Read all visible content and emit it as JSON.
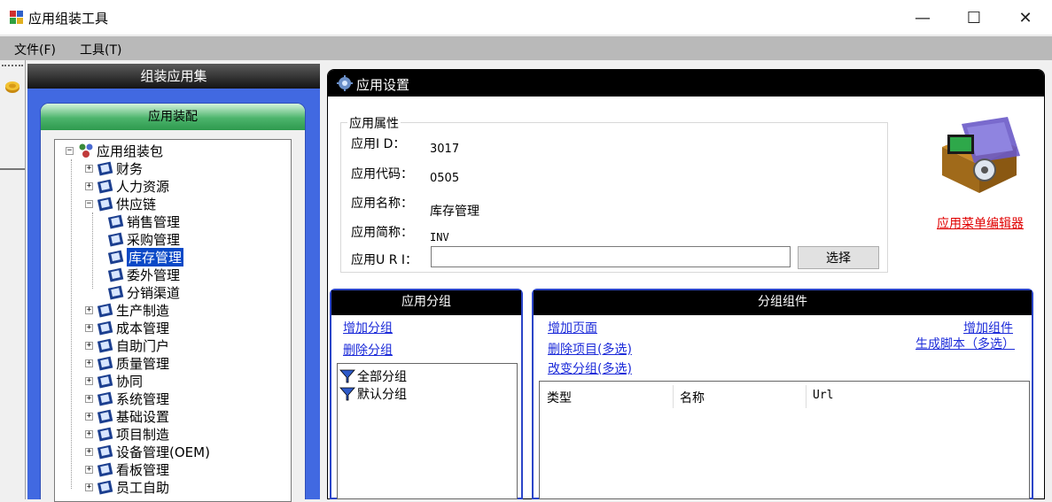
{
  "window": {
    "title": "应用组装工具",
    "minimize": "—",
    "maximize": "☐",
    "close": "✕"
  },
  "menu": [
    "文件(F)",
    "工具(T)"
  ],
  "left_panel": {
    "header": "组装应用集",
    "sub_header": "应用装配",
    "tree": {
      "root": "应用组装包",
      "expand_minus": "−",
      "expand_plus": "+",
      "level1_before": [
        "财务",
        "人力资源"
      ],
      "open_node": "供应链",
      "open_children": [
        "销售管理",
        "采购管理",
        "库存管理",
        "委外管理",
        "分销渠道"
      ],
      "selected": "库存管理",
      "level1_after": [
        "生产制造",
        "成本管理",
        "自助门户",
        "质量管理",
        "协同",
        "系统管理",
        "基础设置",
        "项目制造",
        "设备管理(OEM)",
        "看板管理",
        "员工自助"
      ]
    }
  },
  "right_panel": {
    "header": "应用设置",
    "props_legend": "应用属性",
    "fields": [
      {
        "label": "应用I D：",
        "value": "3017"
      },
      {
        "label": "应用代码：",
        "value": "0505"
      },
      {
        "label": "应用名称：",
        "value": "库存管理"
      },
      {
        "label": "应用简称：",
        "value": "INV"
      }
    ],
    "uri_label": "应用U R I：",
    "uri_value": "",
    "select_button": "选择",
    "menu_editor_link": "应用菜单编辑器"
  },
  "app_groups": {
    "header": "应用分组",
    "add_link": "增加分组",
    "delete_link": "删除分组",
    "items": [
      "全部分组",
      "默认分组"
    ]
  },
  "group_components": {
    "header": "分组组件",
    "add_page": "增加页面",
    "delete_items": "删除项目(多选)",
    "change_group": "改变分组(多选)",
    "add_component": "增加组件",
    "gen_script": "生成脚本（多选）",
    "columns": [
      "类型",
      "名称",
      "Url"
    ]
  },
  "colors": {
    "panel_blue": "#4169e1",
    "selection": "#0a49c7",
    "link": "#1c2bd9",
    "link_red": "#e00000"
  }
}
